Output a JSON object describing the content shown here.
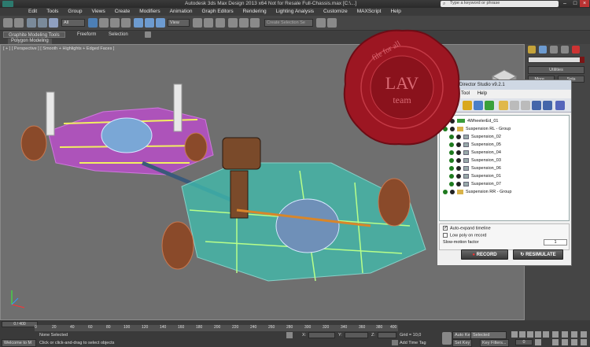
{
  "app": {
    "title": "Autodesk 3ds Max Design 2013 x64    Not for Resale    Full-Chassis.max [C:\\...]",
    "search_placeholder": "Type a keyword or phrase"
  },
  "menu": [
    "Edit",
    "Tools",
    "Group",
    "Views",
    "Create",
    "Modifiers",
    "Animation",
    "Graph Editors",
    "Rendering",
    "Lighting Analysis",
    "Customize",
    "MAXScript",
    "Help"
  ],
  "toolbar": {
    "filter_select": "All",
    "view_select": "View",
    "selection_set_placeholder": "Create Selection Se"
  },
  "ribbon": {
    "tabs": [
      "Graphite Modeling Tools",
      "Freeform",
      "Selection"
    ],
    "subpanel": "Polygon Modeling"
  },
  "viewport": {
    "label": "[ + ] [ Perspective ] [ Smooth + Highlights + Edged Faces ]"
  },
  "command_panel": {
    "utilities_label": "Utilities",
    "more_label": "More...",
    "sets_label": "Sets"
  },
  "seal": {
    "line1": "LAV",
    "line2": "team",
    "ring": "file for all"
  },
  "dialog": {
    "title": "Director Studio v9.2.1",
    "menu": [
      "Tool",
      "Help"
    ],
    "tree": [
      {
        "label": "4WheelerEd_01",
        "icon": "car",
        "indent": 1
      },
      {
        "label": "Suspension RL - Group",
        "icon": "folder",
        "indent": 1
      },
      {
        "label": "Suspension_02",
        "icon": "box",
        "indent": 2
      },
      {
        "label": "Suspension_05",
        "icon": "box",
        "indent": 2
      },
      {
        "label": "Suspension_04",
        "icon": "box",
        "indent": 2
      },
      {
        "label": "Suspension_03",
        "icon": "box",
        "indent": 2
      },
      {
        "label": "Suspension_06",
        "icon": "box",
        "indent": 2
      },
      {
        "label": "Suspension_01",
        "icon": "box",
        "indent": 2
      },
      {
        "label": "Suspension_07",
        "icon": "box",
        "indent": 2
      },
      {
        "label": "Suspension RR - Group",
        "icon": "folder",
        "indent": 1
      }
    ],
    "options": {
      "auto_expand": "Auto-expand timeline",
      "low_poly": "Low poly on record",
      "slow_motion": "Slow-motion factor",
      "slow_motion_value": "1"
    },
    "record_label": "RECORD",
    "resimulate_label": "RESIMULATE"
  },
  "timeline": {
    "frame": "0 / 400",
    "ticks": [
      "0",
      "20",
      "40",
      "60",
      "80",
      "100",
      "120",
      "140",
      "160",
      "180",
      "200",
      "220",
      "240",
      "260",
      "280",
      "300",
      "320",
      "340",
      "360",
      "380",
      "400"
    ]
  },
  "status": {
    "welcome": "Welcome to M",
    "selection": "None Selected",
    "prompt": "Click or click-and-drag to select objects",
    "x_label": "X:",
    "y_label": "Y:",
    "z_label": "Z:",
    "grid": "Grid = 10,0",
    "add_time_tag": "Add Time Tag",
    "auto_key": "Auto Key",
    "set_key": "Set Key",
    "selected": "Selected",
    "key_filters": "Key Filters...",
    "frame_field": "0"
  }
}
